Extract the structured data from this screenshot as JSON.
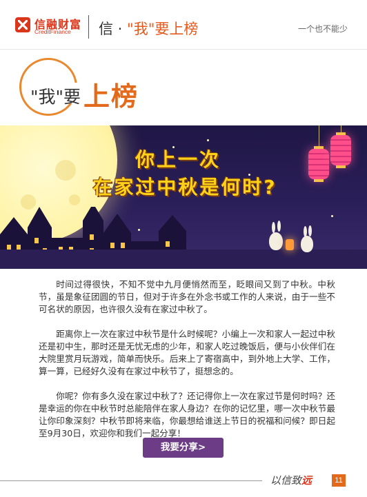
{
  "header": {
    "logo_cn": "信融财富",
    "logo_en": "CreditFinance",
    "title_prefix": "信 · ",
    "title_main": "\"我\"要上榜",
    "slogan": "一个也不能少"
  },
  "section": {
    "title_small": "\"我\"要",
    "title_big": "上榜"
  },
  "banner": {
    "headline_line1": "你上一次",
    "headline_line2": "在家过中秋是何时?"
  },
  "body": {
    "paragraphs": [
      "时间过得很快，不知不觉中九月便悄然而至，眨眼间又到了中秋。中秋节，虽是象征团圆的节日，但对于许多在外念书或工作的人来说，由于一些不可名状的原因，也许很久没有在家过中秋了。",
      "距离你上一次在家过中秋节是什么时候呢？小编上一次和家人一起过中秋还是初中生，那时还是无忧无虑的少年，和家人吃过晚饭后，便与小伙伴们在大院里赏月玩游戏，简单而快乐。后来上了寄宿高中，到外地上大学、工作，算一算，已经好久没有在家过中秋节了，挺想念的。",
      "你呢？你有多久没在家过中秋了？还记得你上一次在家过节是何时吗？还是幸运的你在中秋节时总能陪伴在家人身边？在你的记忆里，哪一次中秋节最让你印象深刻？中秋节即将来临，你最想给谁送上节日的祝福和问候？即日起至9月30日，欢迎你和我们一起分享！"
    ]
  },
  "share_button": {
    "label": "我要分享>"
  },
  "footer": {
    "slogan_prefix": "以信致",
    "slogan_accent": "远",
    "page_number": "11"
  },
  "colors": {
    "brand_red": "#d9361b",
    "accent_orange": "#e46a1b",
    "button_purple": "#6d3c86"
  }
}
